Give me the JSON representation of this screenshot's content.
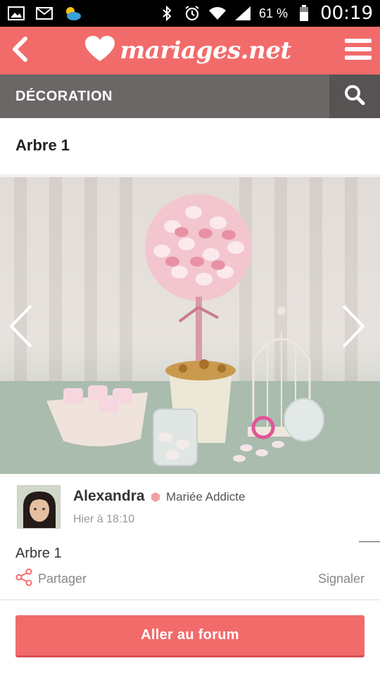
{
  "status_bar": {
    "battery_percent": "61 %",
    "time": "00:19",
    "icons": [
      "image-icon",
      "gmail-icon",
      "weather-icon",
      "bluetooth-icon",
      "alarm-icon",
      "wifi-icon",
      "signal-icon",
      "battery-icon"
    ]
  },
  "header": {
    "logo_text": "mariages.net",
    "back_icon": "chevron-left-icon",
    "menu_icon": "hamburger-menu-icon"
  },
  "category": {
    "title": "DÉCORATION",
    "search_icon": "search-icon"
  },
  "post": {
    "title": "Arbre 1",
    "body": "Arbre 1"
  },
  "author": {
    "name": "Alexandra",
    "badge": "Mariée Addicte",
    "time": "Hier à 18:10"
  },
  "actions": {
    "share_label": "Partager",
    "report_label": "Signaler"
  },
  "footer": {
    "forum_button_label": "Aller au forum"
  },
  "colors": {
    "brand": "#f26b6b",
    "category_bar": "#6b6767",
    "badge": "#f0a0a0"
  }
}
